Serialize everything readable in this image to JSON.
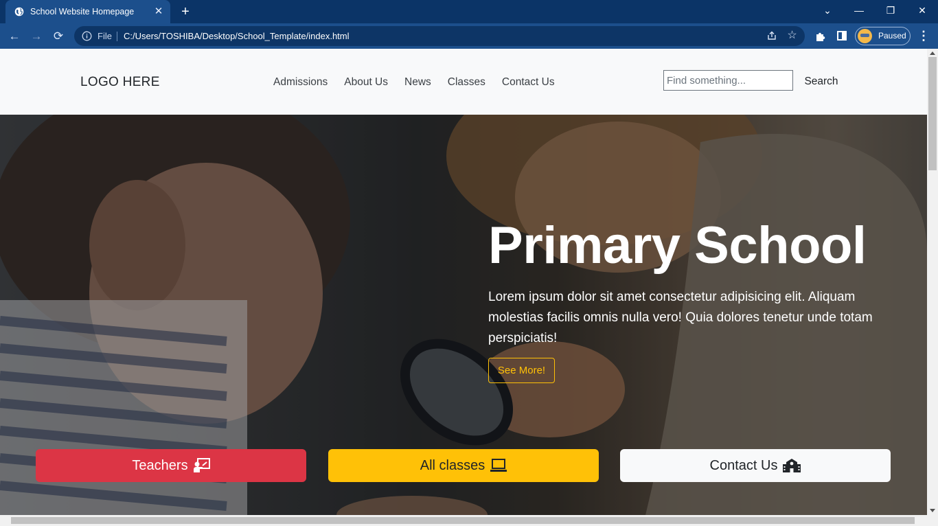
{
  "browser": {
    "tab_title": "School Website Homepage",
    "tab_close": "✕",
    "new_tab": "+",
    "window_controls": {
      "tabsearch": "⌄",
      "minimize": "—",
      "restore": "❐",
      "close": "✕"
    },
    "nav": {
      "back": "←",
      "forward": "→",
      "reload": "⟳"
    },
    "address": {
      "scheme_label": "File",
      "url": "C:/Users/TOSHIBA/Desktop/School_Template/index.html"
    },
    "profile_status": "Paused",
    "menu": "⋮",
    "star": "☆",
    "icons": [
      "globe-icon",
      "info-icon",
      "share-icon",
      "star-icon",
      "puzzle-icon",
      "side-panel-icon",
      "avatar",
      "kebab-menu-icon"
    ]
  },
  "site": {
    "logo": "LOGO HERE",
    "nav_links": [
      "Admissions",
      "About Us",
      "News",
      "Classes",
      "Contact Us"
    ],
    "search": {
      "placeholder": "Find something...",
      "button": "Search"
    }
  },
  "hero": {
    "title": "Primary School",
    "text": "Lorem ipsum dolor sit amet consectetur adipisicing elit. Aliquam molestias facilis omnis nulla vero! Quia dolores tenetur unde totam perspiciatis!",
    "button": "See More!"
  },
  "cta": {
    "teachers": "Teachers",
    "classes": "All classes",
    "contact": "Contact Us"
  },
  "colors": {
    "browser_frame": "#0b3467",
    "browser_toolbar": "#1c4f8c",
    "danger": "#dc3545",
    "warning": "#ffc107",
    "light": "#f8f9fa"
  }
}
